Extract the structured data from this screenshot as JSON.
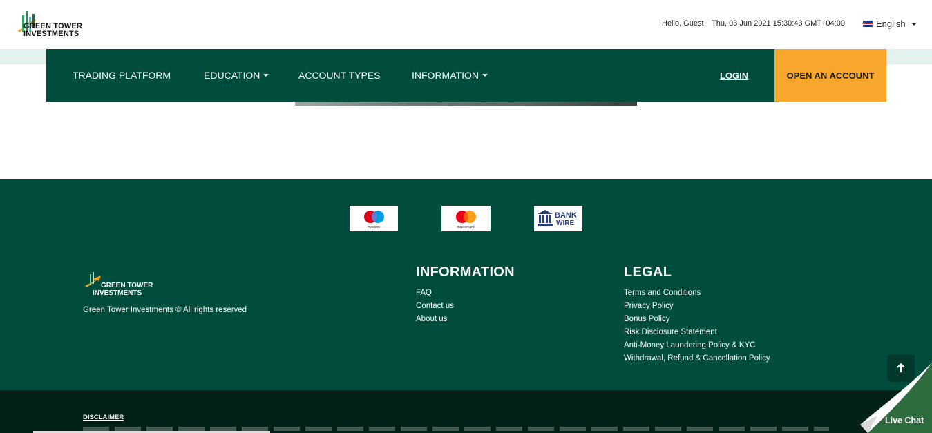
{
  "header": {
    "brand_line1": "GREEN TOWER",
    "brand_line2": "INVESTMENTS",
    "greeting": "Hello, Guest",
    "datetime": "Thu, 03 Jun 2021 15:30:43 GMT+04:00",
    "language": "English",
    "language_icon": "uk-flag-icon"
  },
  "nav": {
    "items": [
      "TRADING PLATFORM",
      "EDUCATION",
      "ACCOUNT TYPES",
      "INFORMATION"
    ],
    "login": "LOGIN",
    "open_account": "OPEN AN ACCOUNT"
  },
  "payments": {
    "maestro": "maestro",
    "mastercard": "mastercard",
    "bank_wire_line1": "BANK",
    "bank_wire_line2": "WIRE"
  },
  "footer": {
    "brand_line1": "GREEN TOWER",
    "brand_line2": "INVESTMENTS",
    "copyright": "Green Tower Investments © All rights reserved",
    "information_title": "INFORMATION",
    "information_links": [
      "FAQ",
      "Contact us",
      "About us"
    ],
    "legal_title": "LEGAL",
    "legal_links": [
      "Terms and Conditions",
      "Privacy Policy",
      "Bonus Policy",
      "Risk Disclosure Statement",
      "Anti-Money Laundering Policy & KYC",
      "Withdrawal, Refund & Cancellation Policy"
    ]
  },
  "disclaimer": {
    "title": "DISCLAIMER"
  },
  "live_chat": {
    "label": "Live Chat"
  },
  "colors": {
    "nav_bg": "#004d3e",
    "cta": "#f7a72b",
    "footer_bg": "#004d3e",
    "disclaimer_bg": "#032118"
  }
}
